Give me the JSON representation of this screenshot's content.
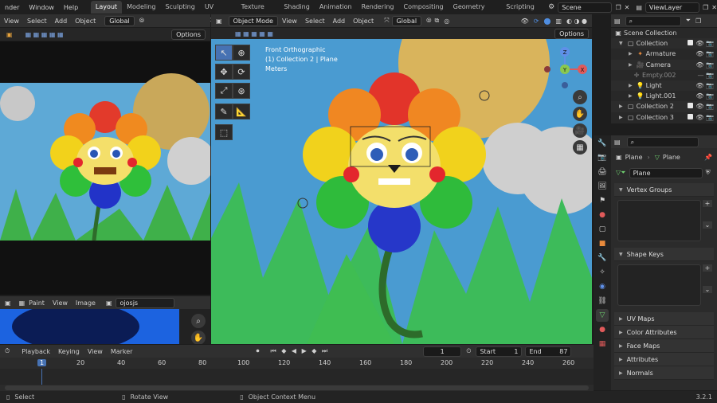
{
  "topbar": {
    "menus": [
      "nder",
      "Window",
      "Help"
    ],
    "tabs": [
      "Layout",
      "Modeling",
      "Sculpting",
      "UV Editing",
      "Texture Paint",
      "Shading",
      "Animation",
      "Rendering",
      "Compositing",
      "Geometry Nodes",
      "Scripting"
    ],
    "active_tab": "Layout",
    "scene": "Scene",
    "view_layer": "ViewLayer"
  },
  "left_header": {
    "view": "View",
    "select": "Select",
    "add": "Add",
    "object": "Object",
    "transform": "Global",
    "options": "Options"
  },
  "viewport": {
    "mode": "Object Mode",
    "view": "View",
    "select": "Select",
    "add": "Add",
    "object": "Object",
    "transform": "Global",
    "options": "Options",
    "overlay_line1": "Front Orthographic",
    "overlay_line2": "(1) Collection 2 | Plane",
    "overlay_line3": "Meters",
    "gizmo": {
      "z": "Z",
      "y": "Y",
      "x": "X"
    }
  },
  "image_editor": {
    "paint": "Paint",
    "view": "View",
    "image": "Image",
    "image_name": "ojosjs"
  },
  "outliner": {
    "search_placeholder": "",
    "items": [
      {
        "label": "Scene Collection",
        "indent": 0
      },
      {
        "label": "Collection",
        "indent": 1
      },
      {
        "label": "Armature",
        "indent": 2
      },
      {
        "label": "Camera",
        "indent": 2
      },
      {
        "label": "Empty.002",
        "indent": 2
      },
      {
        "label": "Light",
        "indent": 2
      },
      {
        "label": "Light.001",
        "indent": 2
      },
      {
        "label": "Collection 2",
        "indent": 1
      },
      {
        "label": "Collection 3",
        "indent": 1
      }
    ]
  },
  "properties": {
    "breadcrumb_a": "Plane",
    "breadcrumb_b": "Plane",
    "data_name": "Plane",
    "panels": [
      "Vertex Groups",
      "Shape Keys",
      "UV Maps",
      "Color Attributes",
      "Face Maps",
      "Attributes",
      "Normals"
    ]
  },
  "timeline": {
    "playback": "Playback",
    "keying": "Keying",
    "view": "View",
    "marker": "Marker",
    "current_frame": "1",
    "start_label": "Start",
    "start": "1",
    "end_label": "End",
    "end": "87",
    "ruler": [
      "1",
      "20",
      "40",
      "60",
      "80",
      "100",
      "120",
      "140",
      "160",
      "180",
      "200",
      "220",
      "240",
      "260"
    ]
  },
  "status": {
    "select": "Select",
    "rotate": "Rotate View",
    "context": "Object Context Menu",
    "version": "3.2.1"
  }
}
